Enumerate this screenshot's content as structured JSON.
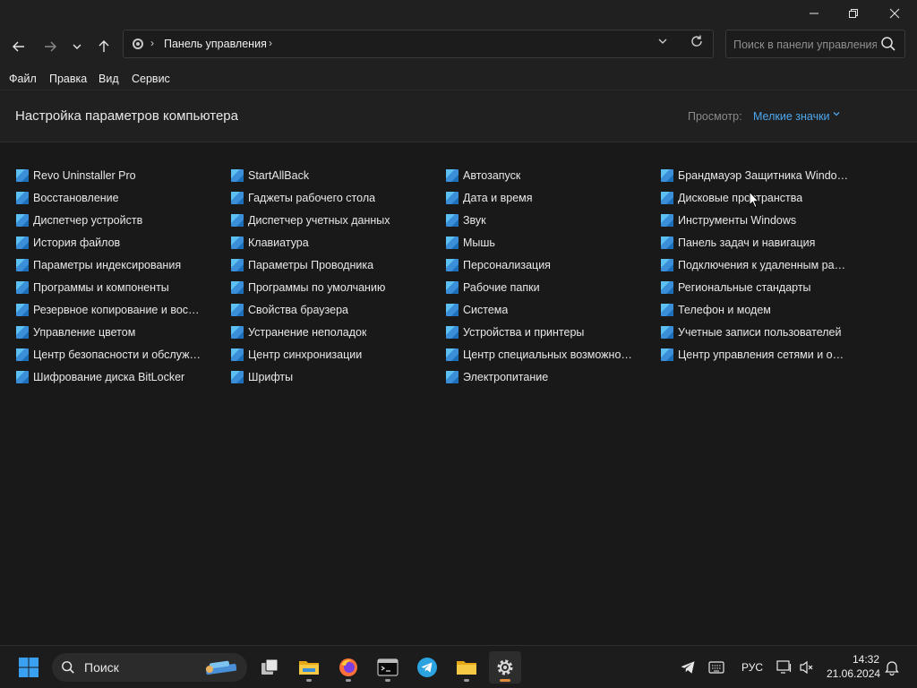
{
  "window": {
    "controls": {
      "minimize": "—",
      "maximize": "❐",
      "close": "✕"
    }
  },
  "nav": {
    "back": "←",
    "forward": "→",
    "recent": "⌄",
    "up": "↑",
    "breadcrumb": "Панель управления",
    "search_placeholder": "Поиск в панели управления"
  },
  "menu": [
    "Файл",
    "Правка",
    "Вид",
    "Сервис"
  ],
  "header": {
    "title": "Настройка параметров компьютера",
    "view_label": "Просмотр:",
    "view_value": "Мелкие значки"
  },
  "items": {
    "col1": [
      "Revo Uninstaller Pro",
      "Восстановление",
      "Диспетчер устройств",
      "История файлов",
      "Параметры индексирования",
      "Программы и компоненты",
      "Резервное копирование и восстан...",
      "Управление цветом",
      "Центр безопасности и обслуживан...",
      "Шифрование диска BitLocker"
    ],
    "col2": [
      "StartAllBack",
      "Гаджеты рабочего стола",
      "Диспетчер учетных данных",
      "Клавиатура",
      "Параметры Проводника",
      "Программы по умолчанию",
      "Свойства браузера",
      "Устранение неполадок",
      "Центр синхронизации",
      "Шрифты"
    ],
    "col3": [
      "Автозапуск",
      "Дата и время",
      "Звук",
      "Мышь",
      "Персонализация",
      "Рабочие папки",
      "Система",
      "Устройства и принтеры",
      "Центр специальных возможностей",
      "Электропитание"
    ],
    "col4": [
      "Брандмауэр Защитника Windows",
      "Дисковые пространства",
      "Инструменты Windows",
      "Панель задач и навигация",
      "Подключения к удаленным рабоч...",
      "Региональные стандарты",
      "Телефон и модем",
      "Учетные записи пользователей",
      "Центр управления сетями и общи..."
    ]
  },
  "taskbar": {
    "search_label": "Поиск",
    "lang": "РУС",
    "time": "14:32",
    "date": "21.06.2024"
  },
  "colors": {
    "accent": "#4ca8f0",
    "background": "#191919",
    "chrome": "#202020"
  }
}
